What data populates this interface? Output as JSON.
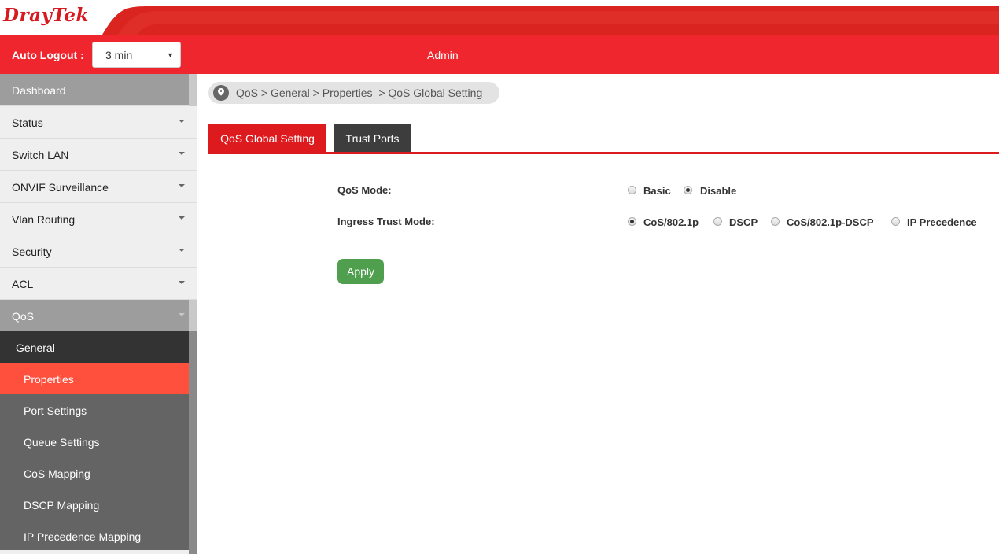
{
  "header": {
    "logo_part1": "Dray",
    "logo_part2": "Tek",
    "auto_logout_label": "Auto Logout :",
    "auto_logout_value": "3 min",
    "user": "Admin"
  },
  "sidebar": {
    "items": [
      {
        "label": "Dashboard"
      },
      {
        "label": "Status"
      },
      {
        "label": "Switch LAN"
      },
      {
        "label": "ONVIF Surveillance"
      },
      {
        "label": "Vlan Routing"
      },
      {
        "label": "Security"
      },
      {
        "label": "ACL"
      },
      {
        "label": "QoS"
      }
    ],
    "qos_group": "General",
    "qos_sub": [
      {
        "label": "Properties"
      },
      {
        "label": "Port Settings"
      },
      {
        "label": "Queue Settings"
      },
      {
        "label": "CoS Mapping"
      },
      {
        "label": "DSCP Mapping"
      },
      {
        "label": "IP Precedence Mapping"
      }
    ]
  },
  "breadcrumb": "QoS > General > Properties  > QoS Global Setting",
  "tabs": [
    {
      "label": "QoS Global Setting"
    },
    {
      "label": "Trust Ports"
    }
  ],
  "form": {
    "qos_mode_label": "QoS Mode:",
    "qos_mode_options": [
      "Basic",
      "Disable"
    ],
    "qos_mode_selected": "Disable",
    "ingress_label": "Ingress Trust Mode:",
    "ingress_options": [
      "CoS/802.1p",
      "DSCP",
      "CoS/802.1p-DSCP",
      "IP Precedence"
    ],
    "ingress_selected": "CoS/802.1p",
    "apply_label": "Apply"
  },
  "colors": {
    "brand_red": "#f0262e",
    "tab_active": "#dd1a1e",
    "apply_green": "#4f9f4f",
    "sidebar_active": "#ff4f3d"
  }
}
